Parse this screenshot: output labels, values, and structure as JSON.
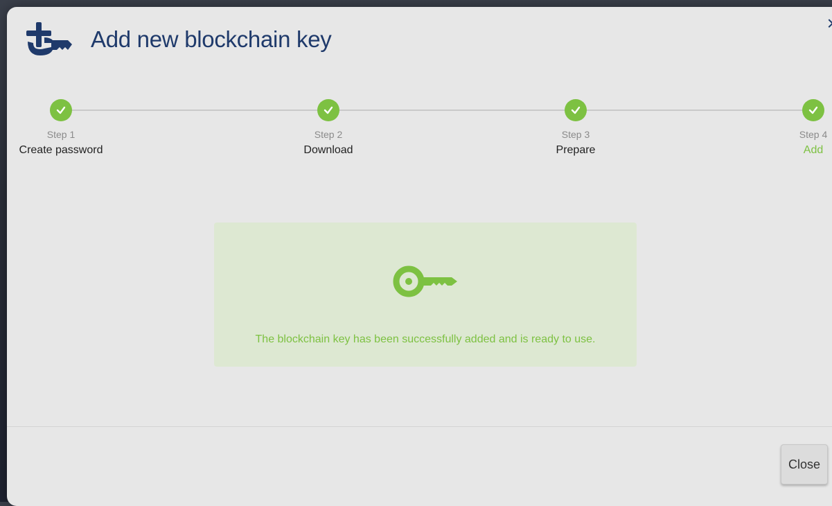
{
  "dialog": {
    "title": "Add new blockchain key",
    "close_icon": "×",
    "icon_name": "add-key-icon"
  },
  "steps": [
    {
      "number": "Step 1",
      "label": "Create password",
      "status": "complete"
    },
    {
      "number": "Step 2",
      "label": "Download",
      "status": "complete"
    },
    {
      "number": "Step 3",
      "label": "Prepare",
      "status": "complete"
    },
    {
      "number": "Step 4",
      "label": "Add",
      "status": "current-complete"
    }
  ],
  "success": {
    "icon_name": "key-icon",
    "message": "The blockchain key has been successfully added and is ready to use."
  },
  "footer": {
    "close_label": "Close"
  },
  "colors": {
    "accent_green": "#7dc142",
    "title_blue": "#1f3a6b",
    "success_bg": "#dde8d2",
    "dialog_bg": "#e7e7e7"
  }
}
